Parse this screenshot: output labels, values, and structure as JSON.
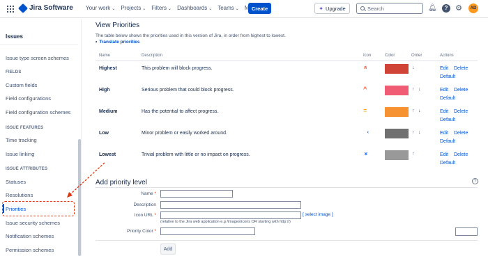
{
  "topbar": {
    "app_name": "Jira Software",
    "nav": [
      "Your work",
      "Projects",
      "Filters",
      "Dashboards",
      "Teams",
      "More"
    ],
    "create": "Create",
    "upgrade": "Upgrade",
    "search_placeholder": "Search",
    "avatar": "AD"
  },
  "sidebar": {
    "title": "Issues",
    "items_top": [
      "Issue type screen schemes"
    ],
    "section_fields": "FIELDS",
    "fields": [
      "Custom fields",
      "Field configurations",
      "Field configuration schemes"
    ],
    "section_features": "ISSUE FEATURES",
    "features": [
      "Time tracking",
      "Issue linking"
    ],
    "section_attributes": "ISSUE ATTRIBUTES",
    "attributes": [
      "Statuses",
      "Resolutions",
      "Priorities",
      "Issue security schemes",
      "Notification schemes",
      "Permission schemes"
    ]
  },
  "main": {
    "title": "View Priorities",
    "description": "The table below shows the priorities used in this version of Jira, in order from highest to lowest.",
    "translate_link": "Translate priorities",
    "headers": {
      "name": "Name",
      "description": "Description",
      "icon": "Icon",
      "color": "Color",
      "order": "Order",
      "actions": "Actions"
    },
    "priorities": [
      {
        "name": "Highest",
        "description": "This problem will block progress.",
        "icon": "»",
        "icon_color": "#ff5630",
        "color": "#d04437",
        "order_up": false,
        "order_down": true
      },
      {
        "name": "High",
        "description": "Serious problem that could block progress.",
        "icon": "^",
        "icon_color": "#ff5630",
        "color": "#f15c75",
        "order_up": true,
        "order_down": true
      },
      {
        "name": "Medium",
        "description": "Has the potential to affect progress.",
        "icon": "=",
        "icon_color": "#ffab00",
        "color": "#f79232",
        "order_up": true,
        "order_down": true
      },
      {
        "name": "Low",
        "description": "Minor problem or easily worked around.",
        "icon": "ˇ",
        "icon_color": "#0065ff",
        "color": "#707070",
        "order_up": true,
        "order_down": true
      },
      {
        "name": "Lowest",
        "description": "Trivial problem with little or no impact on progress.",
        "icon": "»",
        "icon_color": "#0065ff",
        "color": "#999999",
        "order_up": true,
        "order_down": false
      }
    ],
    "action_edit": "Edit",
    "action_delete": "Delete",
    "action_default": "Default"
  },
  "add_form": {
    "title": "Add priority level",
    "name_label": "Name",
    "description_label": "Description",
    "icon_url_label": "Icon URL",
    "select_image": "[ select image ]",
    "hint": "(relative to the Jira web application e.g /images/icons OR starting with http://)",
    "priority_color_label": "Priority Color",
    "add_button": "Add"
  }
}
